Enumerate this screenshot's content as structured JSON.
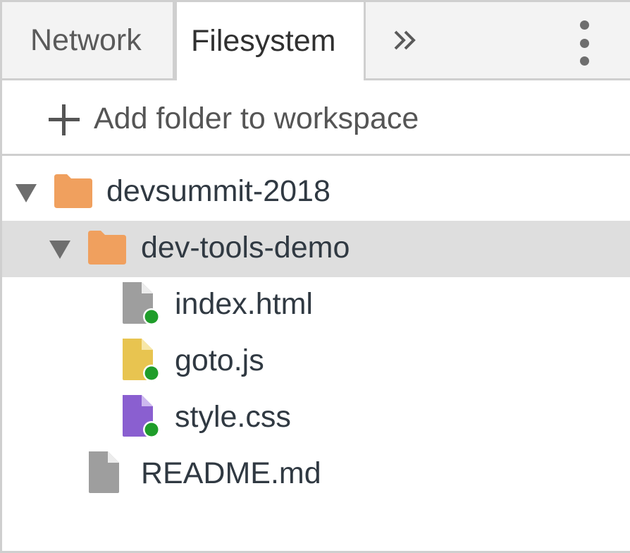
{
  "tabs": {
    "network_label": "Network",
    "filesystem_label": "Filesystem",
    "active": "Filesystem",
    "overflow_icon": "chevron-double-right-icon",
    "menu_icon": "more-vertical-icon"
  },
  "toolbar": {
    "add_folder_label": "Add folder to workspace",
    "add_icon": "plus-icon"
  },
  "tree": {
    "root": {
      "name": "devsummit-2018",
      "expanded": true,
      "icon": "folder-icon"
    },
    "subfolder": {
      "name": "dev-tools-demo",
      "expanded": true,
      "selected": true,
      "icon": "folder-icon"
    },
    "files": [
      {
        "name": "index.html",
        "type": "html",
        "synced": true
      },
      {
        "name": "goto.js",
        "type": "js",
        "synced": true
      },
      {
        "name": "style.css",
        "type": "css",
        "synced": true
      }
    ],
    "root_files": [
      {
        "name": "README.md",
        "type": "md",
        "synced": false
      }
    ]
  },
  "colors": {
    "folder": "#f0a05e",
    "file_generic": "#9e9e9e",
    "file_js": "#e8c450",
    "file_css": "#8a5fd0",
    "sync_dot": "#1f9d2a",
    "selected_row": "#dedede"
  }
}
